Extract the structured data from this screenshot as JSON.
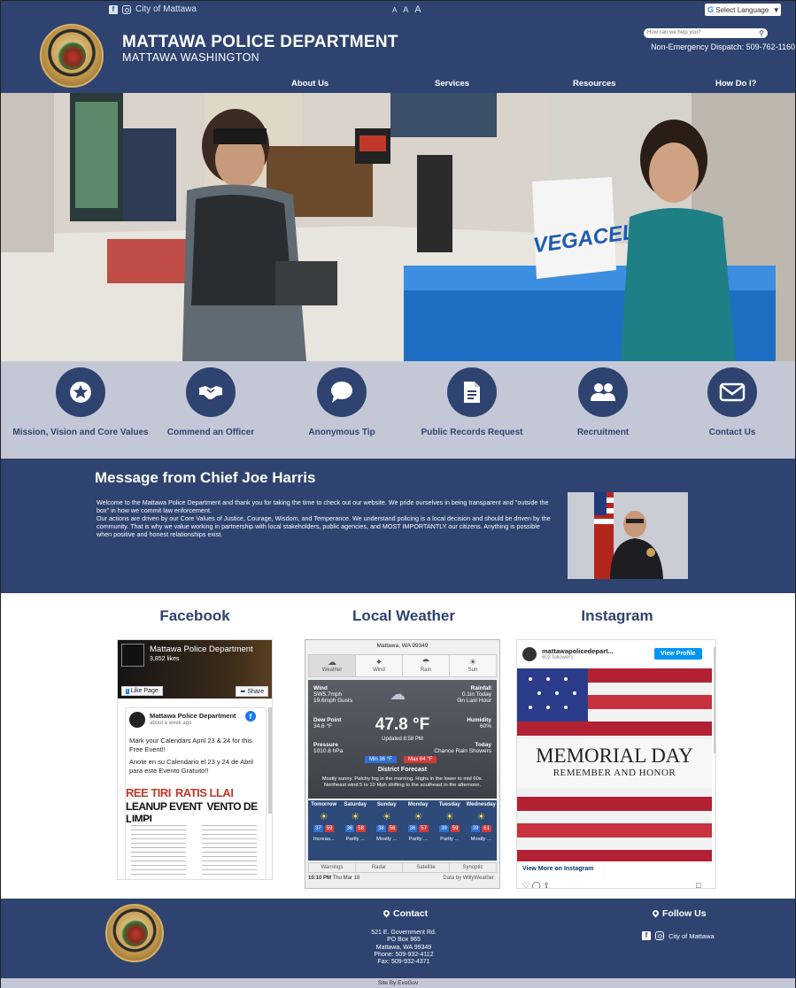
{
  "topbar": {
    "city_link": "City of Mattawa",
    "text_size": [
      "A",
      "A",
      "A"
    ],
    "translate": "Select Language"
  },
  "header": {
    "title": "MATTAWA POLICE DEPARTMENT",
    "subtitle": "MATTAWA WASHINGTON",
    "search_placeholder": "How can we help you?",
    "dispatch": "Non-Emergency Dispatch: 509-762-1160",
    "nav": [
      "About Us",
      "Services",
      "Resources",
      "How Do I?"
    ]
  },
  "quicklinks": [
    {
      "label": "Mission, Vision and Core Values",
      "icon": "star-icon"
    },
    {
      "label": "Commend an Officer",
      "icon": "handshake-icon"
    },
    {
      "label": "Anonymous Tip",
      "icon": "speech-bubble-icon"
    },
    {
      "label": "Public Records Request",
      "icon": "document-icon"
    },
    {
      "label": "Recruitment",
      "icon": "users-icon"
    },
    {
      "label": "Contact Us",
      "icon": "envelope-icon"
    }
  ],
  "chief": {
    "heading": "Message from Chief Joe Harris",
    "message": "Welcome to the Mattawa Police Department and thank you for taking the time to check out our website. We pride ourselves in being transparent and \"outside the box\" in how we commit law enforcement.\nOur actions are driven by our Core Values of Justice, Courage, Wisdom, and Temperance. We understand policing is a local decision and should be driven by the community. That is why we value working in partnership with local stakeholders, public agencies, and MOST IMPORTANTLY our citizens.  Anything is possible when positive and honest relationships exist."
  },
  "sections": {
    "facebook": "Facebook",
    "weather": "Local Weather",
    "instagram": "Instagram"
  },
  "facebook": {
    "page_name": "Mattawa Police Department",
    "likes": "3,852 likes",
    "like_btn": "Like Page",
    "share_btn": "Share",
    "post_author": "Mattawa Police Department",
    "post_time": "about a week ago",
    "post_text_en": "Mark your Calendars April 23 & 24 for this Free Event!!",
    "post_text_es": "Anote en su Calendario el 23 y 24 de Abril para este Evento Gratuito!!",
    "flyer_line1": "REE TIRI",
    "flyer_line1b": "RATIS LLAI",
    "flyer_line2": "LEANUP EVENT",
    "flyer_line2b": "VENTO DE LIMPI"
  },
  "weather": {
    "location": "Mattawa, WA 99349",
    "tabs": [
      "Weather",
      "Wind",
      "Rain",
      "Sun"
    ],
    "wind_label": "Wind",
    "wind": "SW5.7mph",
    "gusts": "19.6mph Gusts",
    "rain_label": "Rainfall",
    "rain_today": "0.1in Today",
    "rain_hour": "0in Last Hour",
    "dew_label": "Dew Point",
    "dew": "34.6 °F",
    "humidity_label": "Humidity",
    "humidity": "60%",
    "pressure_label": "Pressure",
    "pressure": "1010.8 hPa",
    "today_label": "Today",
    "today": "Chance Rain Showers",
    "temp": "47.8 °F",
    "updated": "Updated 8:58 PM",
    "min": "Min 36 °F",
    "max": "Max 64 °F",
    "forecast_title": "District Forecast",
    "forecast": "Mostly sunny. Patchy fog in the morning. Highs in the lower to mid 60s. Northeast wind 5 to 10 Mph shifting to the southeast in the afternoon.",
    "days": [
      "Tomorrow",
      "Saturday",
      "Sunday",
      "Monday",
      "Tuesday",
      "Wednesday"
    ],
    "lows": [
      "37",
      "36",
      "38",
      "36",
      "39",
      "39"
    ],
    "highs": [
      "59",
      "58",
      "56",
      "57",
      "59",
      "61"
    ],
    "summaries": [
      "Increas...",
      "Partly ...",
      "Mostly ...",
      "Partly ...",
      "Partly ...",
      "Mostly ..."
    ],
    "bottom_tabs": [
      "Warnings",
      "Radar",
      "Satellite",
      "Synoptic"
    ],
    "time": "10:10 PM",
    "date": "Thu Mar 18",
    "credit": "Data by WillyWeather"
  },
  "instagram": {
    "account": "mattawapolicedepart...",
    "followers": "602 followers",
    "view_profile": "View Profile",
    "post_title": "MEMORIAL DAY",
    "post_sub": "REMEMBER AND HONOR",
    "more": "View More on Instagram"
  },
  "footer": {
    "contact_heading": "Contact",
    "address": [
      "521 E. Government Rd.",
      "PO Box 965",
      "Mattawa, WA 99349",
      "Phone: 509-932-4112",
      "Fax: 509-932-4371"
    ],
    "follow_heading": "Follow Us",
    "follow_link": "City of Mattawa",
    "credit": "Site By EvoGov"
  },
  "colors": {
    "primary": "#2e4370",
    "icon_band": "#c4c8d6"
  }
}
